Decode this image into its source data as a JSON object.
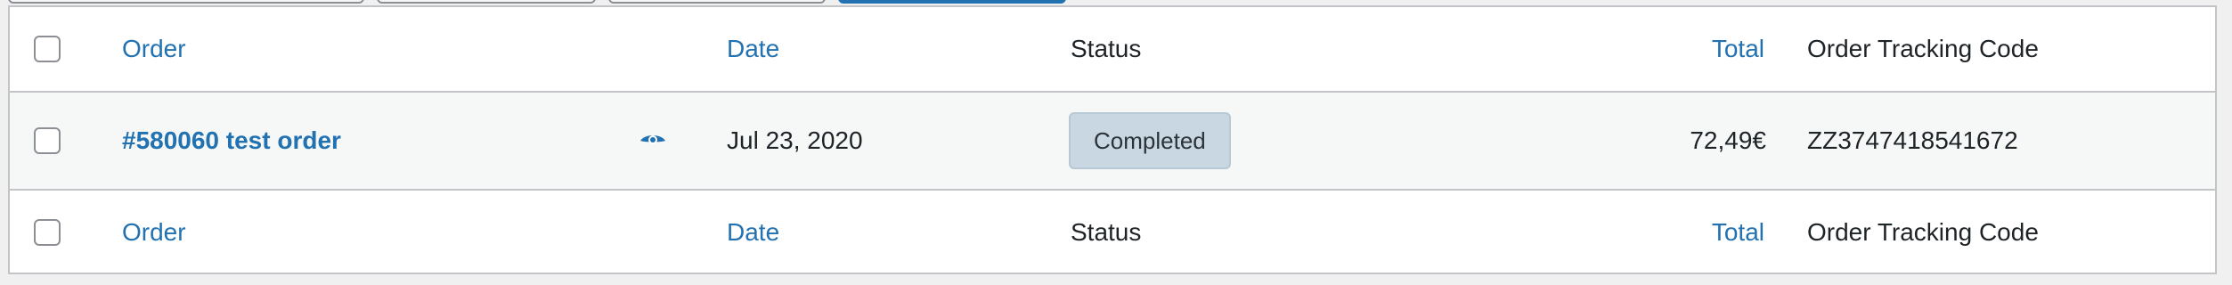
{
  "colors": {
    "link": "#2271b1",
    "text": "#1d2327",
    "border": "#c3c4c7",
    "row_alt_bg": "#f6f7f7",
    "status_completed_bg": "#c8d7e1",
    "status_completed_text": "#2c3338"
  },
  "columns": {
    "order": "Order",
    "date": "Date",
    "status": "Status",
    "total": "Total",
    "tracking": "Order Tracking Code"
  },
  "orders": [
    {
      "title": "#580060 test order",
      "preview_icon": "eye-icon",
      "date": "Jul 23, 2020",
      "status": "Completed",
      "total": "72,49€",
      "tracking_code": "ZZ3747418541672"
    }
  ]
}
